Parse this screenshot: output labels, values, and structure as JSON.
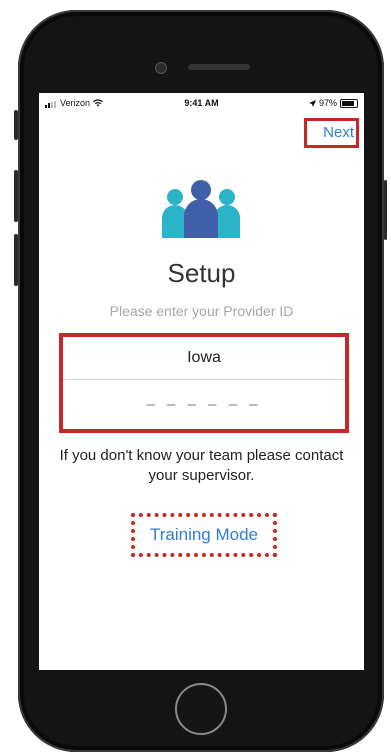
{
  "status_bar": {
    "carrier": "Verizon",
    "time": "9:41 AM",
    "battery": "97%",
    "wifi_icon": "wifi-icon",
    "location_icon": "location-arrow-icon"
  },
  "nav": {
    "next_label": "Next"
  },
  "logo_icon": "team-people-icon",
  "header": {
    "title": "Setup",
    "subtitle": "Please enter your Provider ID"
  },
  "form": {
    "state_value": "Iowa",
    "provider_id_placeholder": "– – – – – –"
  },
  "help_text": "If you don't know your team please contact your supervisor.",
  "training_mode_label": "Training Mode",
  "colors": {
    "accent": "#2f7fd0",
    "highlight": "#c62828",
    "logo_teal": "#2bb3c8",
    "logo_blue": "#3f5fa8"
  }
}
